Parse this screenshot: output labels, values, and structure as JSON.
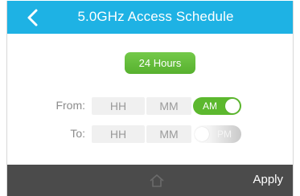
{
  "header": {
    "title": "5.0GHz Access Schedule",
    "back_icon": "chevron-left-icon",
    "background": "#1eb2e4"
  },
  "schedule": {
    "mode_button_label": "24 Hours",
    "mode_button_color": "#5cb82e"
  },
  "from_row": {
    "label": "From:",
    "hour_placeholder": "HH",
    "minute_placeholder": "MM",
    "period_label": "AM",
    "period_active": true
  },
  "to_row": {
    "label": "To:",
    "hour_placeholder": "HH",
    "minute_placeholder": "MM",
    "period_label": "PM",
    "period_active": false
  },
  "footer": {
    "home_icon": "home-icon",
    "apply_label": "Apply",
    "background": "#4b4b4b"
  }
}
